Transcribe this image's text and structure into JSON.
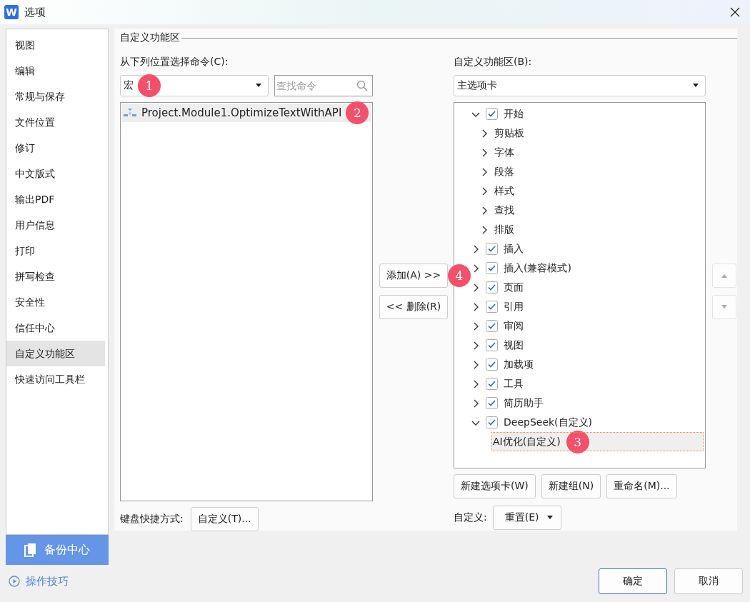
{
  "window": {
    "app_icon": "W",
    "title": "选项"
  },
  "sidebar": {
    "items": [
      {
        "label": "视图",
        "selected": false
      },
      {
        "label": "编辑",
        "selected": false
      },
      {
        "label": "常规与保存",
        "selected": false
      },
      {
        "label": "文件位置",
        "selected": false
      },
      {
        "label": "修订",
        "selected": false
      },
      {
        "label": "中文版式",
        "selected": false
      },
      {
        "label": "输出PDF",
        "selected": false
      },
      {
        "label": "用户信息",
        "selected": false
      },
      {
        "label": "打印",
        "selected": false
      },
      {
        "label": "拼写检查",
        "selected": false
      },
      {
        "label": "安全性",
        "selected": false
      },
      {
        "label": "信任中心",
        "selected": false
      },
      {
        "label": "自定义功能区",
        "selected": true
      },
      {
        "label": "快速访问工具栏",
        "selected": false
      }
    ],
    "backup_button": "备份中心",
    "tips_link": "操作技巧"
  },
  "section_title": "自定义功能区",
  "commands": {
    "label": "从下列位置选择命令(C):",
    "source": "宏",
    "source_badge": "1",
    "search": {
      "placeholder": "查找命令"
    },
    "items": [
      {
        "label": "Project.Module1.OptimizeTextWithAPI",
        "selected": true,
        "badge": "2"
      }
    ],
    "shortcut_label": "键盘快捷方式:",
    "shortcut_button": "自定义(T)..."
  },
  "add_button": "添加(A) >>",
  "add_badge": "4",
  "remove_button": "<< 删除(R)",
  "ribbon": {
    "label": "自定义功能区(B):",
    "scope": "主选项卡",
    "items": [
      {
        "label": "开始",
        "checked": true,
        "expanded": true,
        "selected": false,
        "children": [
          {
            "label": "剪贴板",
            "expanded": false,
            "selected": false
          },
          {
            "label": "字体",
            "expanded": false,
            "selected": false
          },
          {
            "label": "段落",
            "expanded": false,
            "selected": false
          },
          {
            "label": "样式",
            "expanded": false,
            "selected": false
          },
          {
            "label": "查找",
            "expanded": false,
            "selected": false
          },
          {
            "label": "排版",
            "expanded": false,
            "selected": false
          }
        ]
      },
      {
        "label": "插入",
        "checked": true,
        "expanded": false,
        "selected": false
      },
      {
        "label": "插入(兼容模式)",
        "checked": true,
        "expanded": false,
        "selected": false
      },
      {
        "label": "页面",
        "checked": true,
        "expanded": false,
        "selected": false
      },
      {
        "label": "引用",
        "checked": true,
        "expanded": false,
        "selected": false
      },
      {
        "label": "审阅",
        "checked": true,
        "expanded": false,
        "selected": false
      },
      {
        "label": "视图",
        "checked": true,
        "expanded": false,
        "selected": false
      },
      {
        "label": "加载项",
        "checked": true,
        "expanded": false,
        "selected": false
      },
      {
        "label": "工具",
        "checked": true,
        "expanded": false,
        "selected": false
      },
      {
        "label": "简历助手",
        "checked": true,
        "expanded": false,
        "selected": false
      },
      {
        "label": "DeepSeek(自定义)",
        "checked": true,
        "expanded": true,
        "selected": false,
        "children": [
          {
            "label": "AI优化(自定义)",
            "selected": true,
            "badge": "3"
          }
        ]
      }
    ],
    "buttons": [
      "新建选项卡(W)",
      "新建组(N)",
      "重命名(M)..."
    ],
    "reset_label": "自定义:",
    "reset_button": "重置(E)"
  },
  "footer_buttons": [
    "确定",
    "取消"
  ]
}
